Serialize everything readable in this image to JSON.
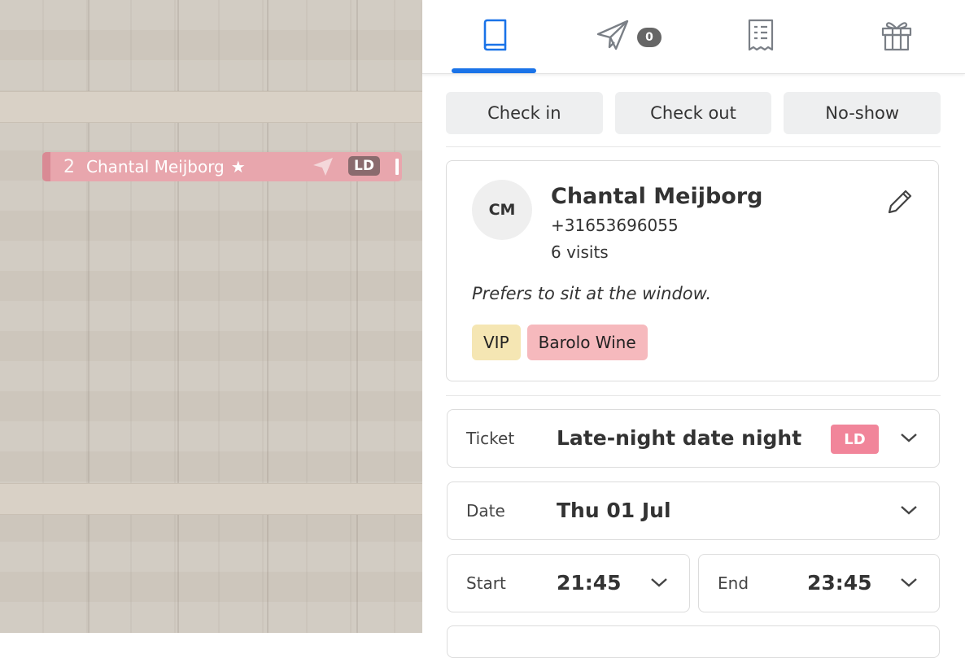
{
  "timeline": {
    "booking": {
      "count": "2",
      "name": "Chantal Meijborg",
      "star": "★",
      "badge": "LD",
      "color": "#e8a6ad"
    }
  },
  "tabs": [
    {
      "icon": "book-icon",
      "active": true
    },
    {
      "icon": "paper-plane-icon",
      "badge": "0"
    },
    {
      "icon": "receipt-icon"
    },
    {
      "icon": "gift-icon"
    }
  ],
  "actions": {
    "check_in": "Check in",
    "check_out": "Check out",
    "no_show": "No-show"
  },
  "guest": {
    "initials": "CM",
    "name": "Chantal Meijborg",
    "phone": "+31653696055",
    "visits": "6 visits",
    "note": "Prefers to sit at the window.",
    "tags": [
      {
        "label": "VIP",
        "color": "#f5e6b3"
      },
      {
        "label": "Barolo Wine",
        "color": "#f6b9bd"
      }
    ]
  },
  "ticket": {
    "label": "Ticket",
    "value": "Late-night date night",
    "badge": "LD",
    "badge_color": "#f1859a"
  },
  "date": {
    "label": "Date",
    "value": "Thu 01 Jul"
  },
  "start": {
    "label": "Start",
    "value": "21:45"
  },
  "end": {
    "label": "End",
    "value": "23:45"
  },
  "accent": "#1a73e8"
}
